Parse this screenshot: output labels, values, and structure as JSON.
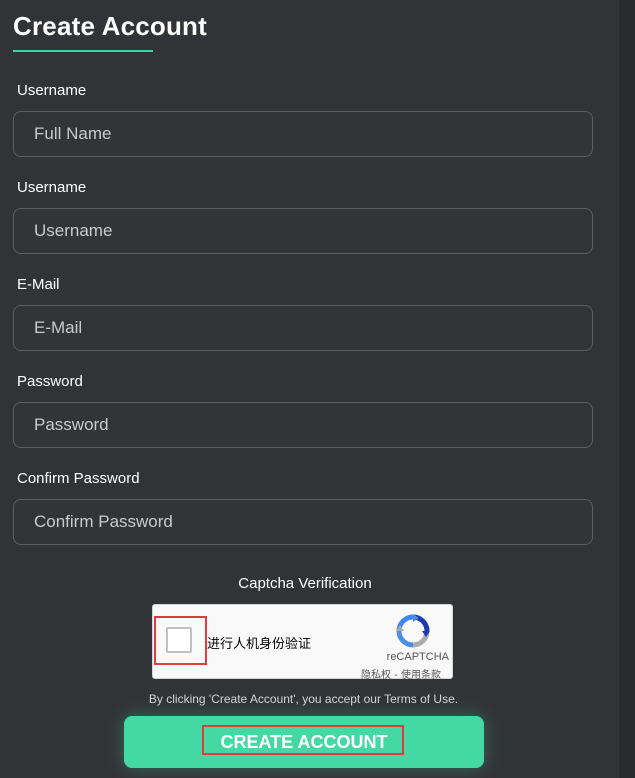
{
  "header": {
    "title": "Create Account"
  },
  "form": {
    "fields": [
      {
        "label": "Username",
        "placeholder": "Full Name",
        "value": ""
      },
      {
        "label": "Username",
        "placeholder": "Username",
        "value": ""
      },
      {
        "label": "E-Mail",
        "placeholder": "E-Mail",
        "value": ""
      },
      {
        "label": "Password",
        "placeholder": "Password",
        "value": ""
      },
      {
        "label": "Confirm Password",
        "placeholder": "Confirm Password",
        "value": ""
      }
    ]
  },
  "captcha": {
    "label": "Captcha Verification",
    "checkbox_text": "进行人机身份验证",
    "checked": false,
    "brand": "reCAPTCHA",
    "privacy_link": "隐私权",
    "separator": " - ",
    "terms_link": "使用条款"
  },
  "terms": {
    "prefix": "By clicking 'Create Account', you accept our ",
    "link": "Terms of Use",
    "suffix": "."
  },
  "submit": {
    "label": "CREATE ACCOUNT"
  },
  "colors": {
    "accent": "#43d8a4",
    "panel_bg": "#323337",
    "highlight_border": "#e23b3b"
  }
}
